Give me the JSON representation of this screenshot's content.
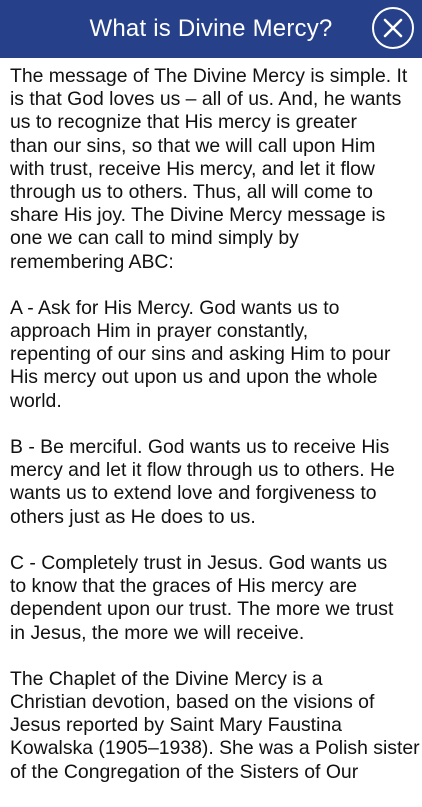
{
  "header": {
    "title": "What is Divine Mercy?",
    "close_icon": "close-icon",
    "background_color": "#26418a"
  },
  "content": {
    "paragraphs": [
      {
        "lines": [
          "The message of The Divine Mercy is simple. It",
          "is that God loves us – all of us. And, he wants",
          "us to recognize that His mercy is greater",
          "than our sins, so that we will call upon Him",
          "with trust, receive His mercy, and let it flow",
          "through us to others. Thus, all will come to",
          "share His joy. The Divine Mercy message is",
          "one we can call to mind simply by",
          "remembering ABC:"
        ]
      },
      {
        "lines": [
          "A - Ask for His Mercy. God wants us to",
          "approach Him in prayer constantly,",
          "repenting of our sins and asking Him to pour",
          "His mercy out upon us and upon the whole",
          "world."
        ]
      },
      {
        "lines": [
          "B - Be merciful. God wants us to receive His",
          "mercy and let it flow through us to others. He",
          "wants us to extend love and forgiveness to",
          "others just as He does to us."
        ]
      },
      {
        "lines": [
          "C - Completely trust in Jesus. God wants us",
          "to know that the graces of His mercy are",
          "dependent upon our trust. The more we trust",
          "in Jesus, the more we will receive."
        ]
      },
      {
        "lines": [
          "The Chaplet of the Divine Mercy is a",
          "Christian devotion, based on the visions of",
          "Jesus reported by Saint Mary Faustina",
          "Kowalska (1905–1938). She was a Polish sister",
          "of the Congregation of the Sisters of Our"
        ]
      }
    ]
  }
}
